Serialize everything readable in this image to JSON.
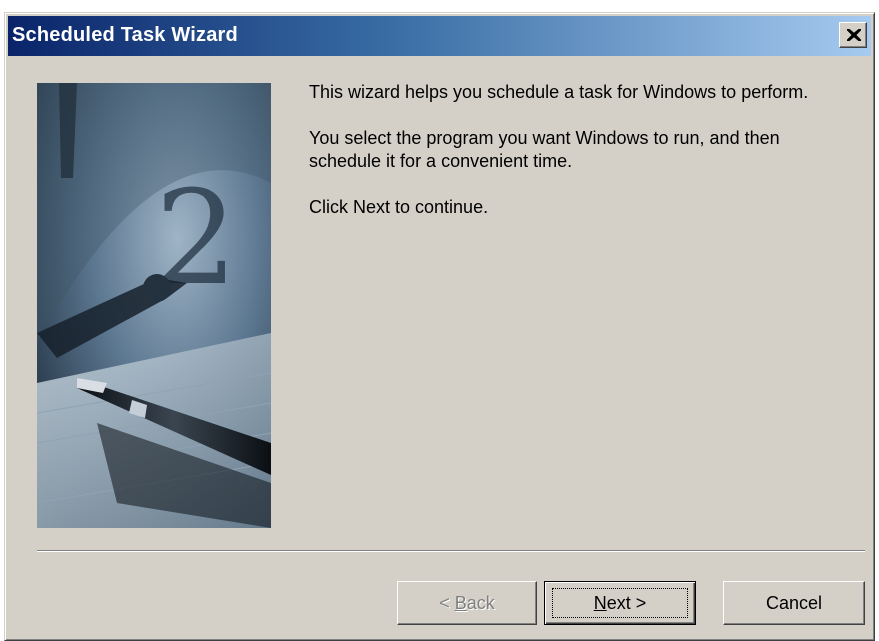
{
  "window": {
    "title": "Scheduled Task Wizard",
    "close_icon": "close-icon"
  },
  "intro": {
    "line1": "This wizard helps you schedule a task for Windows to perform.",
    "line2": "You select the program you want Windows to run, and then schedule it for a convenient time.",
    "line3": "Click Next to continue."
  },
  "buttons": {
    "back_prefix": "< ",
    "back_mnemonic": "B",
    "back_rest": "ack",
    "next_mnemonic": "N",
    "next_rest": "ext >",
    "cancel": "Cancel"
  },
  "image": {
    "icon": "clock-and-pen-illustration"
  },
  "colors": {
    "title_active_start": "#0a246a",
    "title_active_end": "#a6caf0",
    "dialog_face": "#d4d0c8"
  }
}
